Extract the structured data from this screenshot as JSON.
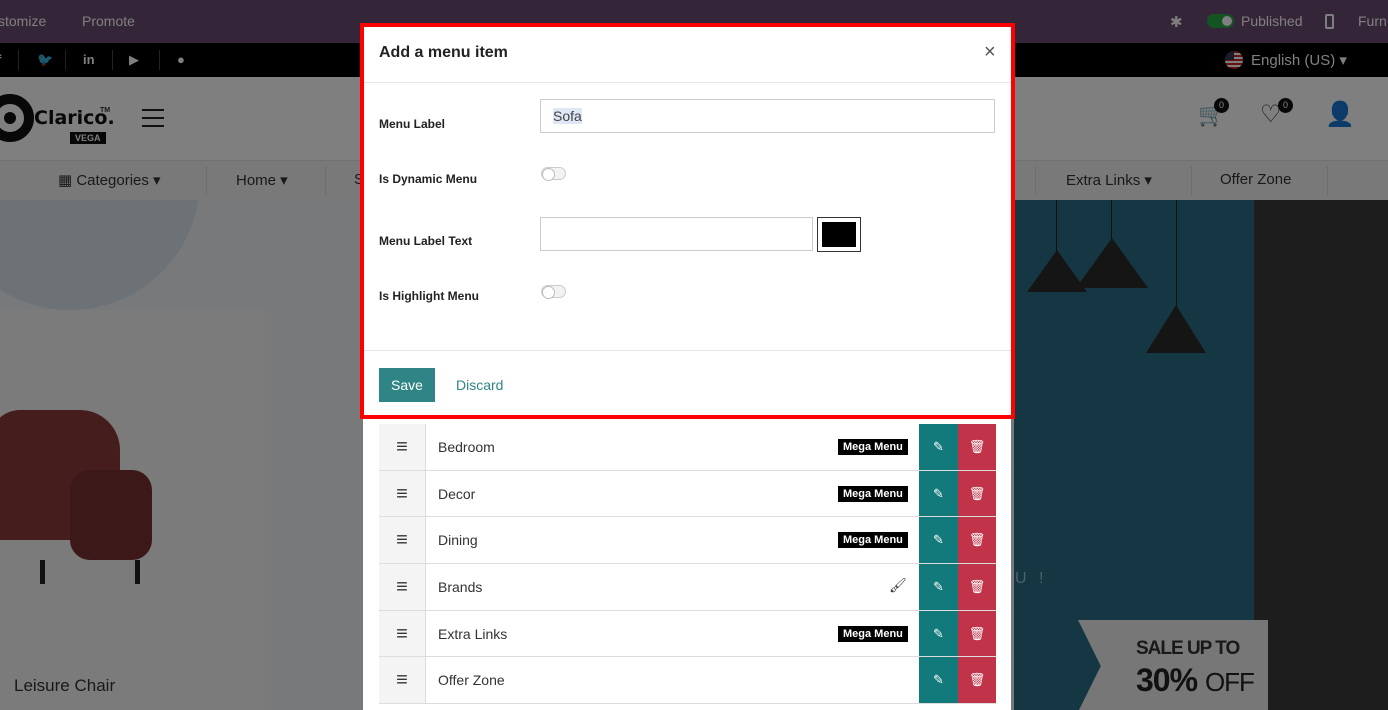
{
  "topbar": {
    "customize": "stomize",
    "promote": "Promote",
    "published": "Published",
    "furn": "Furn"
  },
  "socialbar": {
    "language": "English (US)"
  },
  "header": {
    "logo": "Clarico.",
    "logo_tm": "TM",
    "logo_sub": "VEGA",
    "cart_count": "0",
    "wishlist_count": "0"
  },
  "navbar": {
    "items": [
      "Categories",
      "Home",
      "S",
      "Extra Links",
      "Offer Zone"
    ]
  },
  "hero": {
    "product_title": "Leisure Chair",
    "sale_top": "SALE UP TO",
    "sale_percent": "30%",
    "sale_off": "OFF",
    "hidden_text": "U !"
  },
  "menu_list": {
    "badge": "Mega Menu",
    "rows": [
      {
        "label": "Bedroom",
        "type": "mega"
      },
      {
        "label": "Decor",
        "type": "mega"
      },
      {
        "label": "Dining",
        "type": "mega"
      },
      {
        "label": "Brands",
        "type": "brush"
      },
      {
        "label": "Extra Links",
        "type": "mega"
      },
      {
        "label": "Offer Zone",
        "type": "none"
      }
    ]
  },
  "modal": {
    "title": "Add a menu item",
    "close": "×",
    "fields": {
      "menu_label": {
        "label": "Menu Label",
        "value": "Sofa"
      },
      "is_dynamic_menu": {
        "label": "Is Dynamic Menu",
        "checked": false
      },
      "menu_label_text": {
        "label": "Menu Label Text",
        "value": "",
        "color": "#000000"
      },
      "is_highlight_menu": {
        "label": "Is Highlight Menu",
        "checked": false
      }
    },
    "save_label": "Save",
    "discard_label": "Discard"
  },
  "colors": {
    "topbar": "#6b4a73",
    "accent_teal": "#2f8585",
    "delete_red": "#c13349",
    "highlight_border": "#ff0000"
  }
}
